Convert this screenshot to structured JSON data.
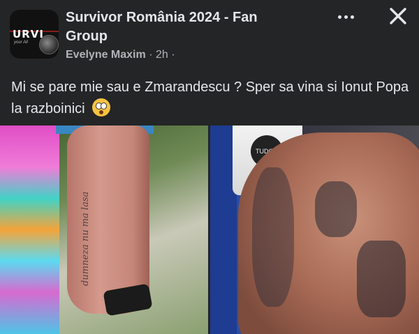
{
  "group": {
    "name": "Survivor România 2024 - Fan Group",
    "avatar_logo_text": "URVI",
    "avatar_logo_sub": "your All"
  },
  "post": {
    "author": "Evelyne Maxim",
    "time": "2h",
    "separator": "·",
    "text": "Mi se pare mie sau e Zmarandescu ?  Sper sa vina si Ionut Popa la razboinici",
    "emoji": "flushed-face-icon"
  },
  "header_actions": {
    "more_icon": "more-horizontal-icon",
    "close_icon": "close-icon"
  },
  "photos": {
    "left": {
      "tattoo_text": "dumneza nu ma lasa"
    },
    "right": {
      "bag_text": "TUDOR"
    }
  },
  "colors": {
    "background": "#242526",
    "text_primary": "#e4e6eb",
    "text_secondary": "#b0b3b8"
  }
}
